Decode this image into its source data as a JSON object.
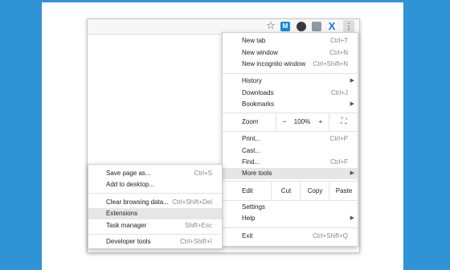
{
  "toolbar": {
    "ext_m_label": "M",
    "ext_x_label": "X"
  },
  "menu": {
    "new_tab": {
      "label": "New tab",
      "shortcut": "Ctrl+T"
    },
    "new_window": {
      "label": "New window",
      "shortcut": "Ctrl+N"
    },
    "new_incognito": {
      "label": "New incognito window",
      "shortcut": "Ctrl+Shift+N"
    },
    "history": {
      "label": "History"
    },
    "downloads": {
      "label": "Downloads",
      "shortcut": "Ctrl+J"
    },
    "bookmarks": {
      "label": "Bookmarks"
    },
    "zoom": {
      "label": "Zoom",
      "minus": "−",
      "level": "100%",
      "plus": "+"
    },
    "print": {
      "label": "Print...",
      "shortcut": "Ctrl+P"
    },
    "cast": {
      "label": "Cast..."
    },
    "find": {
      "label": "Find...",
      "shortcut": "Ctrl+F"
    },
    "more_tools": {
      "label": "More tools"
    },
    "edit": {
      "label": "Edit",
      "cut": "Cut",
      "copy": "Copy",
      "paste": "Paste"
    },
    "settings": {
      "label": "Settings"
    },
    "help": {
      "label": "Help"
    },
    "exit": {
      "label": "Exit",
      "shortcut": "Ctrl+Shift+Q"
    }
  },
  "submenu": {
    "save_page": {
      "label": "Save page as...",
      "shortcut": "Ctrl+S"
    },
    "add_desktop": {
      "label": "Add to desktop..."
    },
    "clear_browsing": {
      "label": "Clear browsing data...",
      "shortcut": "Ctrl+Shift+Del"
    },
    "extensions": {
      "label": "Extensions"
    },
    "task_manager": {
      "label": "Task manager",
      "shortcut": "Shift+Esc"
    },
    "developer_tools": {
      "label": "Developer tools",
      "shortcut": "Ctrl+Shift+I"
    }
  },
  "colors": {
    "background": "#2f93d6",
    "highlight": "#e6e6e6"
  }
}
